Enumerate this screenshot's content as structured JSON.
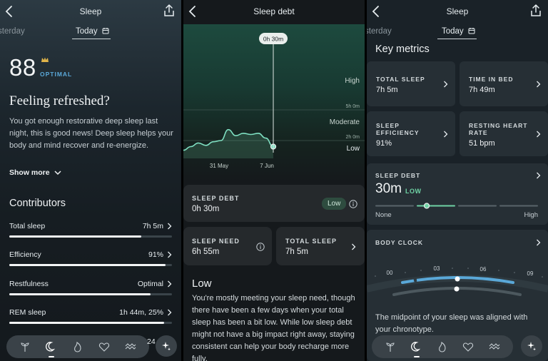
{
  "panel1": {
    "header_title": "Sleep",
    "tab_yesterday": "Yesterday",
    "tab_today": "Today",
    "score": "88",
    "score_label": "OPTIMAL",
    "headline": "Feeling refreshed?",
    "description": "You got enough restorative deep sleep last night, this is good news! Deep sleep helps your body and mind recover and re-energize.",
    "show_more": "Show more",
    "contributors_title": "Contributors",
    "contributors": [
      {
        "label": "Total sleep",
        "value": "7h 5m",
        "level": 0.81
      },
      {
        "label": "Efficiency",
        "value": "91%",
        "level": 0.96
      },
      {
        "label": "Restfulness",
        "value": "Optimal",
        "level": 0.87
      },
      {
        "label": "REM sleep",
        "value": "1h 44m, 25%",
        "level": 0.95
      }
    ],
    "peek_text": "24"
  },
  "panel2": {
    "header_title": "Sleep debt",
    "tooltip": "0h 30m",
    "level_high": "High",
    "level_moderate": "Moderate",
    "level_low": "Low",
    "gridline_5h": "5h 0m",
    "gridline_2h": "2h 0m",
    "x_label_1": "31 May",
    "x_label_2": "7 Jun",
    "sleep_debt_label": "SLEEP DEBT",
    "sleep_debt_value": "0h 30m",
    "sleep_debt_pill": "Low",
    "sleep_need_label": "SLEEP NEED",
    "sleep_need_value": "6h 55m",
    "total_sleep_label": "TOTAL SLEEP",
    "total_sleep_value": "7h 5m",
    "section_heading": "Low",
    "section_text": "You're mostly meeting your sleep need, though there have been a few days when your total sleep has been a bit low. While low sleep debt might not have a big impact right away, staying consistent can help your body recharge more fully."
  },
  "panel3": {
    "header_title": "Sleep",
    "tab_yesterday": "Yesterday",
    "tab_today": "Today",
    "key_metrics_title": "Key metrics",
    "metrics": [
      {
        "label": "TOTAL SLEEP",
        "value": "7h 5m"
      },
      {
        "label": "TIME IN BED",
        "value": "7h 49m"
      },
      {
        "label": "SLEEP EFFICIENCY",
        "value": "91%"
      },
      {
        "label": "RESTING HEART RATE",
        "value": "51 bpm"
      }
    ],
    "sleep_debt_label": "SLEEP DEBT",
    "sleep_debt_value": "30m",
    "sleep_debt_level": "LOW",
    "scale_min": "None",
    "scale_max": "High",
    "body_clock_label": "BODY CLOCK",
    "clock_ticks": [
      "00",
      "03",
      "06",
      "09"
    ],
    "body_clock_text": "The midpoint of your sleep was aligned with your chronotype."
  },
  "chart_data": {
    "type": "area",
    "title": "Sleep debt",
    "x_tick_labels": [
      "31 May",
      "7 Jun"
    ],
    "bands": [
      "High",
      "Moderate",
      "Low"
    ],
    "gridlines": [
      "5h 0m",
      "2h 0m"
    ],
    "selected_value": "0h 30m",
    "series": [
      {
        "values_hours": [
          0.2,
          0.5,
          0.8,
          0.6,
          0.9,
          1.0,
          1.9,
          1.4,
          1.6,
          1.5,
          1.6,
          1.2,
          0.5
        ]
      }
    ]
  },
  "colors": {
    "accent_blue": "#5aa8d8",
    "low_green": "#6fd3a5",
    "chart_line": "#7fe0c2"
  }
}
